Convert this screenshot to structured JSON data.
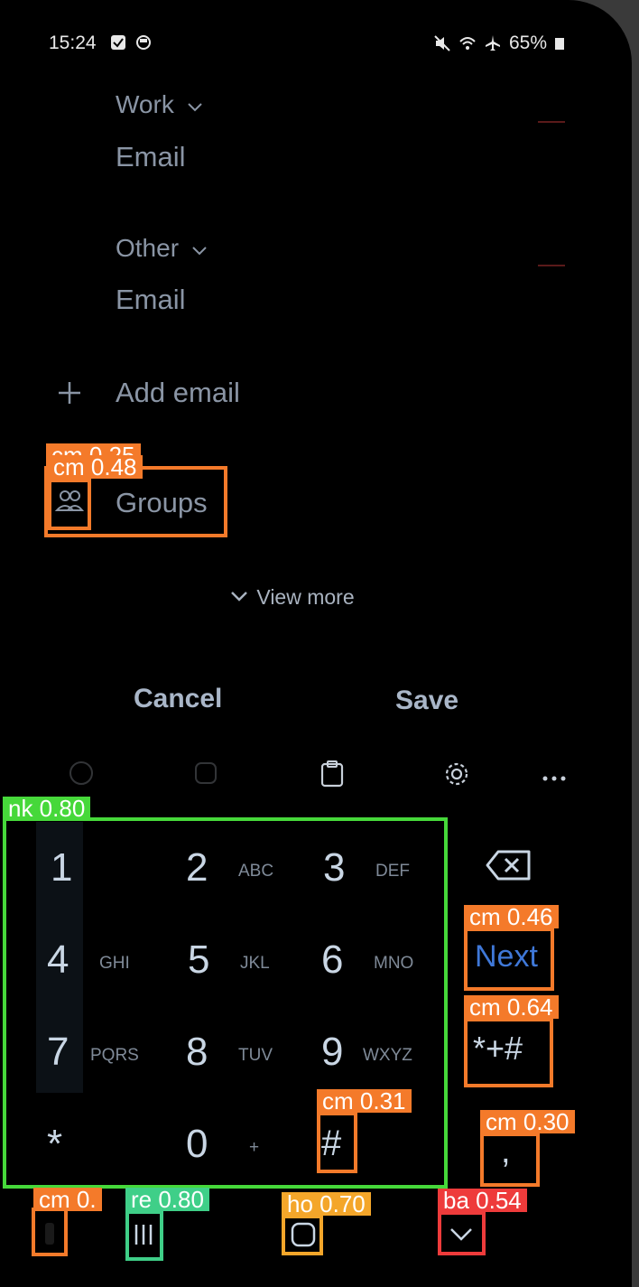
{
  "status": {
    "time": "15:24",
    "battery": "65%"
  },
  "form": {
    "work_label": "Work",
    "work_field": "Email",
    "other_label": "Other",
    "other_field": "Email",
    "add_email": "Add email",
    "groups": "Groups",
    "view_more": "View more"
  },
  "actions": {
    "cancel": "Cancel",
    "save": "Save"
  },
  "keypad": {
    "keys": [
      {
        "num": "1",
        "letters": ""
      },
      {
        "num": "2",
        "letters": "ABC"
      },
      {
        "num": "3",
        "letters": "DEF"
      },
      {
        "num": "4",
        "letters": "GHI"
      },
      {
        "num": "5",
        "letters": "JKL"
      },
      {
        "num": "6",
        "letters": "MNO"
      },
      {
        "num": "7",
        "letters": "PQRS"
      },
      {
        "num": "8",
        "letters": "TUV"
      },
      {
        "num": "9",
        "letters": "WXYZ"
      },
      {
        "num": "*",
        "letters": ""
      },
      {
        "num": "0",
        "letters": "+"
      },
      {
        "num": "#",
        "letters": ""
      }
    ],
    "next": "Next",
    "symbols": "*+#",
    "comma": ","
  },
  "detections": {
    "groups_outer": "cm 0.25",
    "groups_inner": "cm 0.48",
    "keypad": "nk 0.80",
    "next": "cm 0.46",
    "symbols": "cm 0.64",
    "hash": "cm 0.31",
    "comma": "cm 0.30",
    "nav_left": "cm 0.",
    "recents": "re 0.80",
    "home": "ho 0.70",
    "back": "ba 0.54"
  },
  "colors": {
    "orange": "#f47a2a",
    "green": "#46d83a",
    "mint": "#3fcf88",
    "yellow": "#f4a62a",
    "red": "#ee3b3b",
    "next_blue": "#3f78d8"
  }
}
